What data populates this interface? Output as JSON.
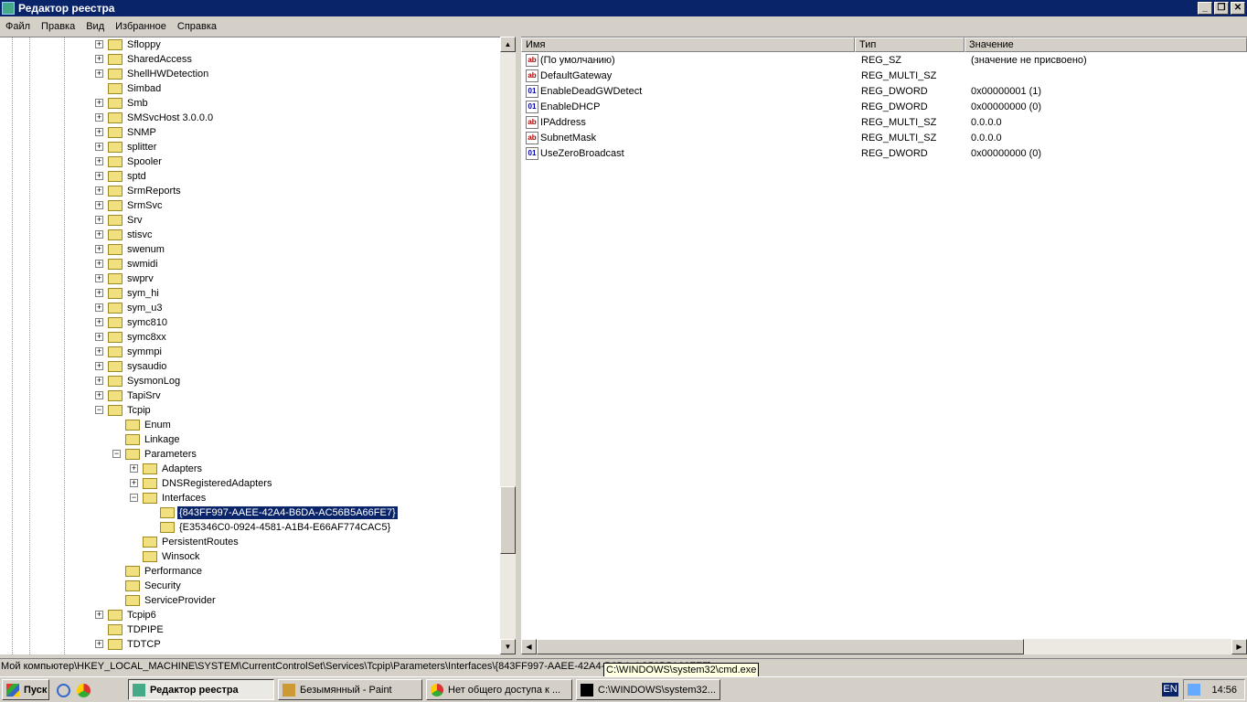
{
  "window": {
    "title": "Редактор реестра"
  },
  "menu": [
    "Файл",
    "Правка",
    "Вид",
    "Избранное",
    "Справка"
  ],
  "tree": [
    {
      "label": "Sfloppy",
      "depth": 0,
      "exp": "+"
    },
    {
      "label": "SharedAccess",
      "depth": 0,
      "exp": "+"
    },
    {
      "label": "ShellHWDetection",
      "depth": 0,
      "exp": "+"
    },
    {
      "label": "Simbad",
      "depth": 0,
      "exp": ""
    },
    {
      "label": "Smb",
      "depth": 0,
      "exp": "+"
    },
    {
      "label": "SMSvcHost 3.0.0.0",
      "depth": 0,
      "exp": "+"
    },
    {
      "label": "SNMP",
      "depth": 0,
      "exp": "+"
    },
    {
      "label": "splitter",
      "depth": 0,
      "exp": "+"
    },
    {
      "label": "Spooler",
      "depth": 0,
      "exp": "+"
    },
    {
      "label": "sptd",
      "depth": 0,
      "exp": "+"
    },
    {
      "label": "SrmReports",
      "depth": 0,
      "exp": "+"
    },
    {
      "label": "SrmSvc",
      "depth": 0,
      "exp": "+"
    },
    {
      "label": "Srv",
      "depth": 0,
      "exp": "+"
    },
    {
      "label": "stisvc",
      "depth": 0,
      "exp": "+"
    },
    {
      "label": "swenum",
      "depth": 0,
      "exp": "+"
    },
    {
      "label": "swmidi",
      "depth": 0,
      "exp": "+"
    },
    {
      "label": "swprv",
      "depth": 0,
      "exp": "+"
    },
    {
      "label": "sym_hi",
      "depth": 0,
      "exp": "+"
    },
    {
      "label": "sym_u3",
      "depth": 0,
      "exp": "+"
    },
    {
      "label": "symc810",
      "depth": 0,
      "exp": "+"
    },
    {
      "label": "symc8xx",
      "depth": 0,
      "exp": "+"
    },
    {
      "label": "symmpi",
      "depth": 0,
      "exp": "+"
    },
    {
      "label": "sysaudio",
      "depth": 0,
      "exp": "+"
    },
    {
      "label": "SysmonLog",
      "depth": 0,
      "exp": "+"
    },
    {
      "label": "TapiSrv",
      "depth": 0,
      "exp": "+"
    },
    {
      "label": "Tcpip",
      "depth": 0,
      "exp": "-"
    },
    {
      "label": "Enum",
      "depth": 1,
      "exp": ""
    },
    {
      "label": "Linkage",
      "depth": 1,
      "exp": ""
    },
    {
      "label": "Parameters",
      "depth": 1,
      "exp": "-"
    },
    {
      "label": "Adapters",
      "depth": 2,
      "exp": "+"
    },
    {
      "label": "DNSRegisteredAdapters",
      "depth": 2,
      "exp": "+"
    },
    {
      "label": "Interfaces",
      "depth": 2,
      "exp": "-"
    },
    {
      "label": "{843FF997-AAEE-42A4-B6DA-AC56B5A66FE7}",
      "depth": 3,
      "exp": "",
      "selected": true
    },
    {
      "label": "{E35346C0-0924-4581-A1B4-E66AF774CAC5}",
      "depth": 3,
      "exp": ""
    },
    {
      "label": "PersistentRoutes",
      "depth": 2,
      "exp": ""
    },
    {
      "label": "Winsock",
      "depth": 2,
      "exp": ""
    },
    {
      "label": "Performance",
      "depth": 1,
      "exp": ""
    },
    {
      "label": "Security",
      "depth": 1,
      "exp": ""
    },
    {
      "label": "ServiceProvider",
      "depth": 1,
      "exp": ""
    },
    {
      "label": "Tcpip6",
      "depth": 0,
      "exp": "+"
    },
    {
      "label": "TDPIPE",
      "depth": 0,
      "exp": ""
    },
    {
      "label": "TDTCP",
      "depth": 0,
      "exp": "+"
    }
  ],
  "columns": [
    "Имя",
    "Тип",
    "Значение"
  ],
  "values": [
    {
      "icon": "ab",
      "name": "(По умолчанию)",
      "type": "REG_SZ",
      "value": "(значение не присвоено)"
    },
    {
      "icon": "ab",
      "name": "DefaultGateway",
      "type": "REG_MULTI_SZ",
      "value": ""
    },
    {
      "icon": "bin",
      "name": "EnableDeadGWDetect",
      "type": "REG_DWORD",
      "value": "0x00000001 (1)"
    },
    {
      "icon": "bin",
      "name": "EnableDHCP",
      "type": "REG_DWORD",
      "value": "0x00000000 (0)"
    },
    {
      "icon": "ab",
      "name": "IPAddress",
      "type": "REG_MULTI_SZ",
      "value": "0.0.0.0"
    },
    {
      "icon": "ab",
      "name": "SubnetMask",
      "type": "REG_MULTI_SZ",
      "value": "0.0.0.0"
    },
    {
      "icon": "bin",
      "name": "UseZeroBroadcast",
      "type": "REG_DWORD",
      "value": "0x00000000 (0)"
    }
  ],
  "status": "Мой компьютер\\HKEY_LOCAL_MACHINE\\SYSTEM\\CurrentControlSet\\Services\\Tcpip\\Parameters\\Interfaces\\{843FF997-AAEE-42A4-B6DA-AC56B5A66FE7}",
  "tooltip": "C:\\WINDOWS\\system32\\cmd.exe",
  "taskbar": {
    "start": "Пуск",
    "tasks": [
      "Редактор реестра",
      "Безымянный - Paint",
      "Нет общего доступа к ...",
      "C:\\WINDOWS\\system32..."
    ],
    "lang": "EN",
    "clock": "14:56"
  }
}
